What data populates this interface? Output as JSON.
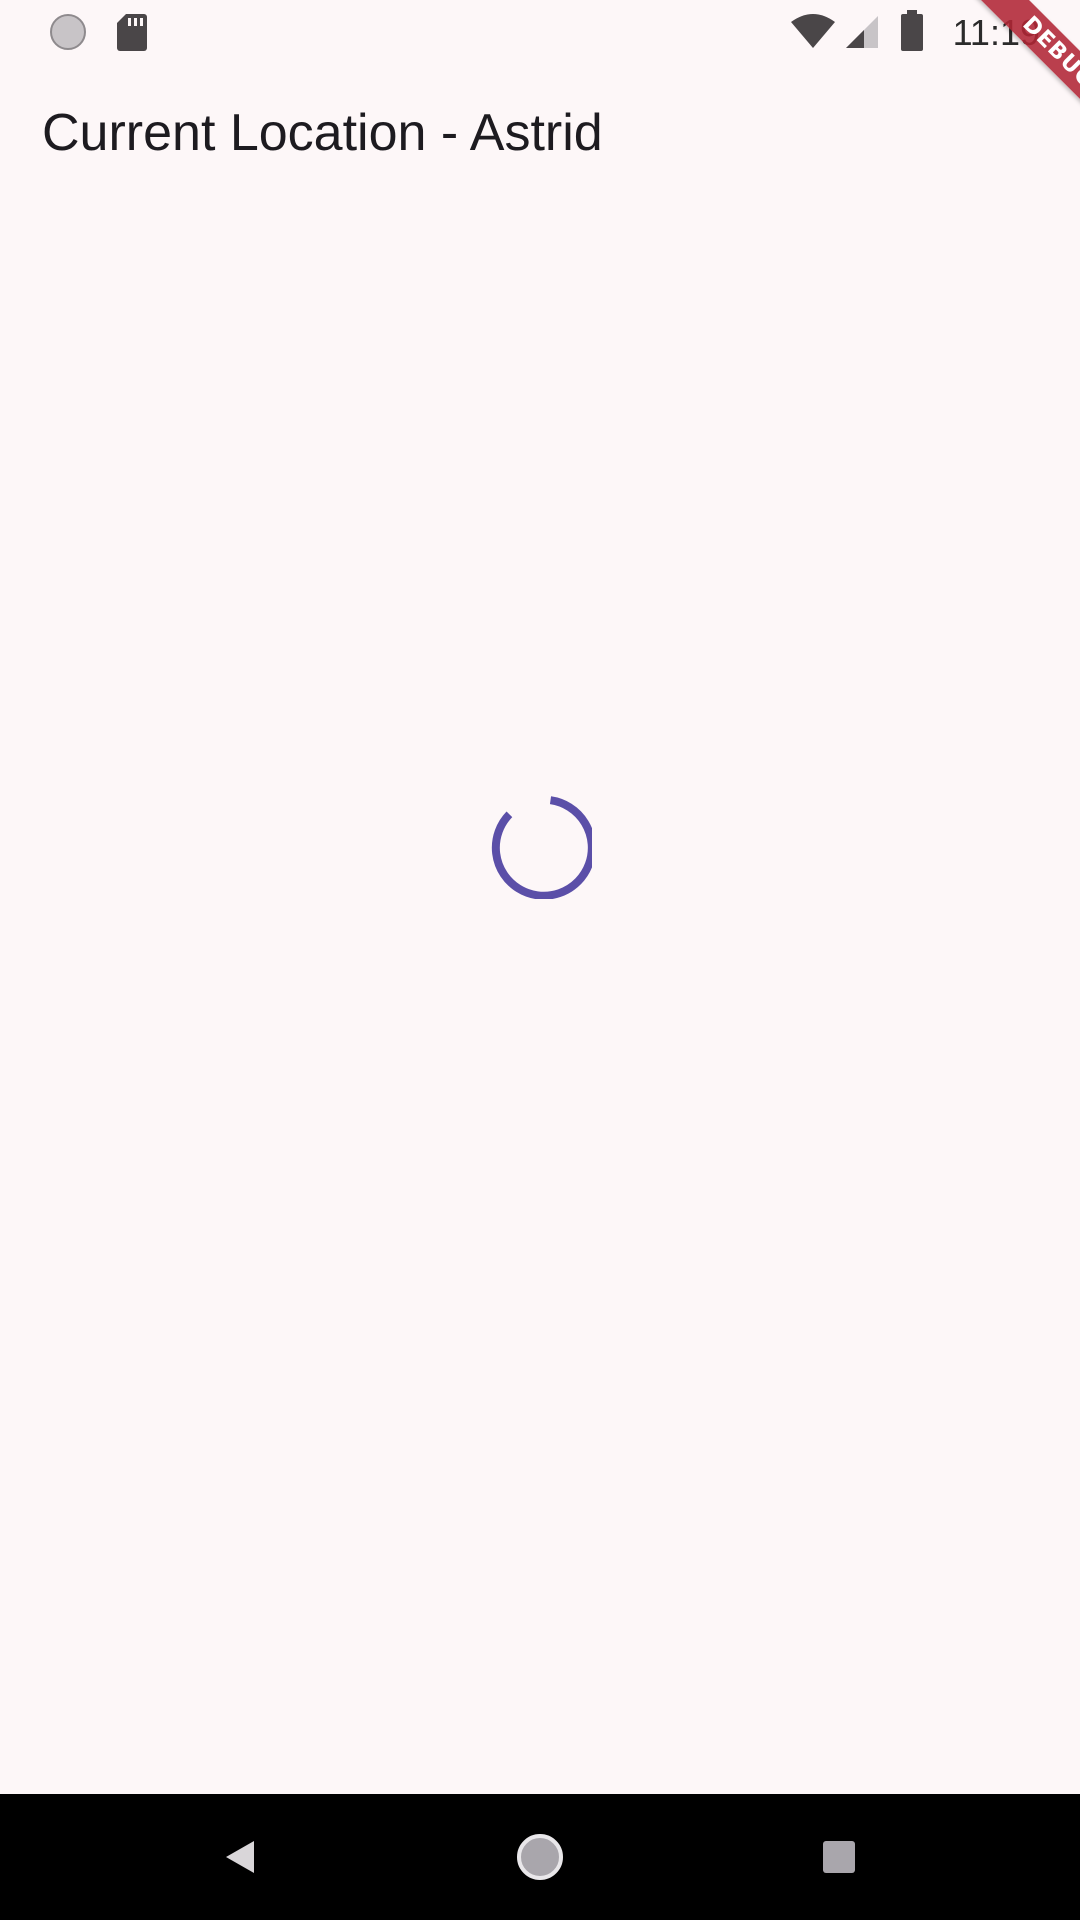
{
  "status_bar": {
    "time": "11:19",
    "left_icons": [
      "record-dot-icon",
      "sd-card-icon"
    ],
    "right_icons": [
      "wifi-icon",
      "cell-signal-icon",
      "battery-icon"
    ]
  },
  "debug_banner": {
    "label": "DEBUG",
    "color": "#b02634"
  },
  "app_bar": {
    "title": "Current Location - Astrid"
  },
  "content": {
    "state": "loading",
    "spinner_color": "#5b4fa8"
  },
  "nav_bar": {
    "buttons": [
      "back-icon",
      "home-icon",
      "recents-icon"
    ]
  },
  "colors": {
    "background": "#fdf7f8",
    "text": "#1d1b20",
    "nav_background": "#000000"
  }
}
